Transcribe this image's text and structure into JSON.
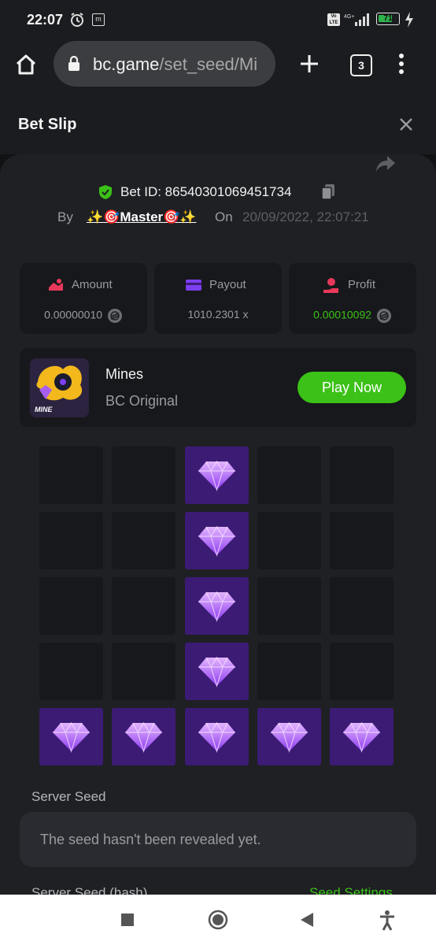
{
  "status_bar": {
    "time": "22:07",
    "m_badge": "m",
    "volte": "Vo LTE",
    "network": "4G+",
    "battery": "71",
    "battery_level": 0.71
  },
  "browser": {
    "url_host": "bc.game",
    "url_path": "/set_seed/Mi",
    "tab_count": "3"
  },
  "header": {
    "title": "Bet Slip"
  },
  "bet": {
    "bet_id": "Bet ID: 86540301069451734",
    "by_label": "By",
    "user": "✨🎯Master🎯✨",
    "on_label": "On",
    "date": "20/09/2022, 22:07:21"
  },
  "stats": [
    {
      "label": "Amount",
      "value": "0.00000010",
      "has_coin": true,
      "color": "#9a9b9f"
    },
    {
      "label": "Payout",
      "value": "1010.2301 x",
      "has_coin": false,
      "color": "#9a9b9f"
    },
    {
      "label": "Profit",
      "value": "0.00010092",
      "has_coin": true,
      "color": "#3bc117"
    }
  ],
  "game": {
    "title": "Mines",
    "subtitle": "BC Original",
    "thumb_label": "MINE",
    "play_label": "Play Now"
  },
  "grid": [
    [
      0,
      0,
      1,
      0,
      0
    ],
    [
      0,
      0,
      1,
      0,
      0
    ],
    [
      0,
      0,
      1,
      0,
      0
    ],
    [
      0,
      0,
      1,
      0,
      0
    ],
    [
      1,
      1,
      1,
      1,
      1
    ]
  ],
  "seed": {
    "server_seed_label": "Server Seed",
    "server_seed_value": "The seed hasn't been revealed yet.",
    "hash_label": "Server Seed (hash)",
    "settings_label": "Seed Settings"
  },
  "colors": {
    "accent_green": "#3bc117",
    "gem_tile": "#3c1b75",
    "empty_tile": "#17181b"
  }
}
